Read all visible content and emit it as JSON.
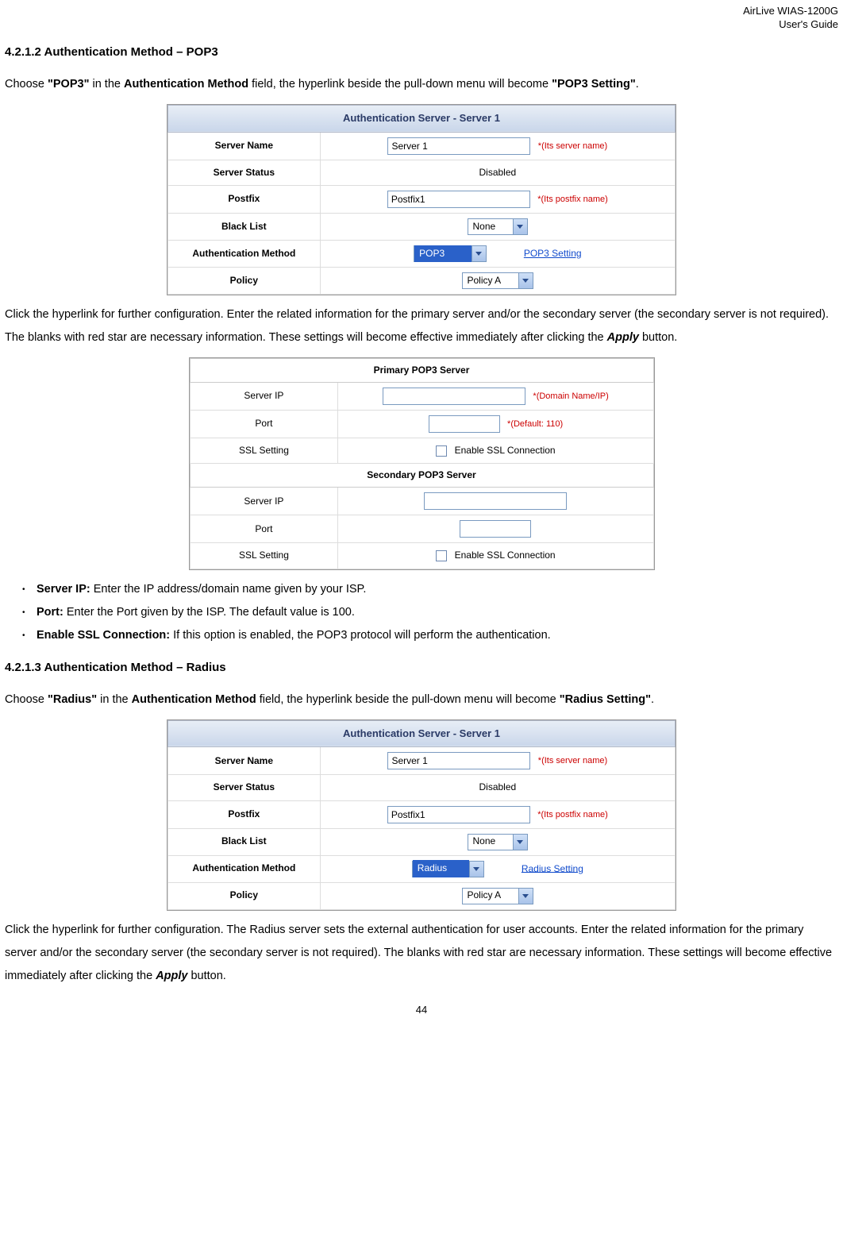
{
  "header": {
    "product": "AirLive WIAS-1200G",
    "subtitle": "User's Guide"
  },
  "sec1": {
    "heading": "4.2.1.2  Authentication Method – POP3",
    "para1a": "Choose ",
    "para1b": "\"POP3\"",
    "para1c": " in the ",
    "para1d": "Authentication Method",
    "para1e": " field, the hyperlink beside the pull-down menu will become ",
    "para1f": "\"POP3 Setting\"",
    "para1g": "."
  },
  "fig1": {
    "title": "Authentication Server - Server 1",
    "rows": {
      "server_name": {
        "label": "Server Name",
        "value": "Server 1",
        "hint": "*(Its server name)"
      },
      "server_status": {
        "label": "Server Status",
        "value": "Disabled"
      },
      "postfix": {
        "label": "Postfix",
        "value": "Postfix1",
        "hint": "*(Its postfix name)"
      },
      "black_list": {
        "label": "Black List",
        "value": "None"
      },
      "auth_method": {
        "label": "Authentication Method",
        "value": "POP3",
        "link": "POP3 Setting"
      },
      "policy": {
        "label": "Policy",
        "value": "Policy A"
      }
    }
  },
  "sec1p2a": "Click the hyperlink for further configuration. Enter the related information for the primary server and/or the secondary server (the secondary server is not required). The blanks with red star are necessary information. These settings will become effective immediately after clicking the ",
  "sec1p2b": "Apply",
  "sec1p2c": " button.",
  "fig2": {
    "title1": "Primary POP3 Server",
    "primary": {
      "server_ip": {
        "label": "Server IP",
        "hint": "*(Domain Name/IP)"
      },
      "port": {
        "label": "Port",
        "hint": "*(Default: 110)"
      },
      "ssl": {
        "label": "SSL Setting",
        "text": "Enable SSL Connection"
      }
    },
    "title2": "Secondary POP3 Server",
    "secondary": {
      "server_ip": {
        "label": "Server IP"
      },
      "port": {
        "label": "Port"
      },
      "ssl": {
        "label": "SSL Setting",
        "text": "Enable SSL Connection"
      }
    }
  },
  "bullets": {
    "b1a": "Server IP:",
    "b1b": " Enter the IP address/domain name given by your ISP.",
    "b2a": "Port:",
    "b2b": " Enter the Port given by the ISP. The default value is 100.",
    "b3a": "Enable SSL Connection:",
    "b3b": " If this option is enabled, the POP3 protocol will perform the authentication."
  },
  "sec2": {
    "heading": "4.2.1.3  Authentication Method – Radius",
    "para1a": "Choose ",
    "para1b": "\"Radius\"",
    "para1c": " in the ",
    "para1d": "Authentication Method",
    "para1e": " field, the hyperlink beside the pull-down menu will become ",
    "para1f": "\"Radius Setting\"",
    "para1g": "."
  },
  "fig3": {
    "title": "Authentication Server - Server 1",
    "rows": {
      "server_name": {
        "label": "Server Name",
        "value": "Server 1",
        "hint": "*(Its server name)"
      },
      "server_status": {
        "label": "Server Status",
        "value": "Disabled"
      },
      "postfix": {
        "label": "Postfix",
        "value": "Postfix1",
        "hint": "*(Its postfix name)"
      },
      "black_list": {
        "label": "Black List",
        "value": "None"
      },
      "auth_method": {
        "label": "Authentication Method",
        "value": "Radius",
        "link": "Radius Setting"
      },
      "policy": {
        "label": "Policy",
        "value": "Policy A"
      }
    }
  },
  "sec2p2a": "Click the hyperlink for further configuration. The Radius server sets the external authentication for user accounts. Enter the related information for the primary server and/or the secondary server (the secondary server is not required). The blanks with red star are necessary information. These settings will become effective immediately after clicking the ",
  "sec2p2b": "Apply",
  "sec2p2c": " button.",
  "footer": {
    "page": "44"
  }
}
